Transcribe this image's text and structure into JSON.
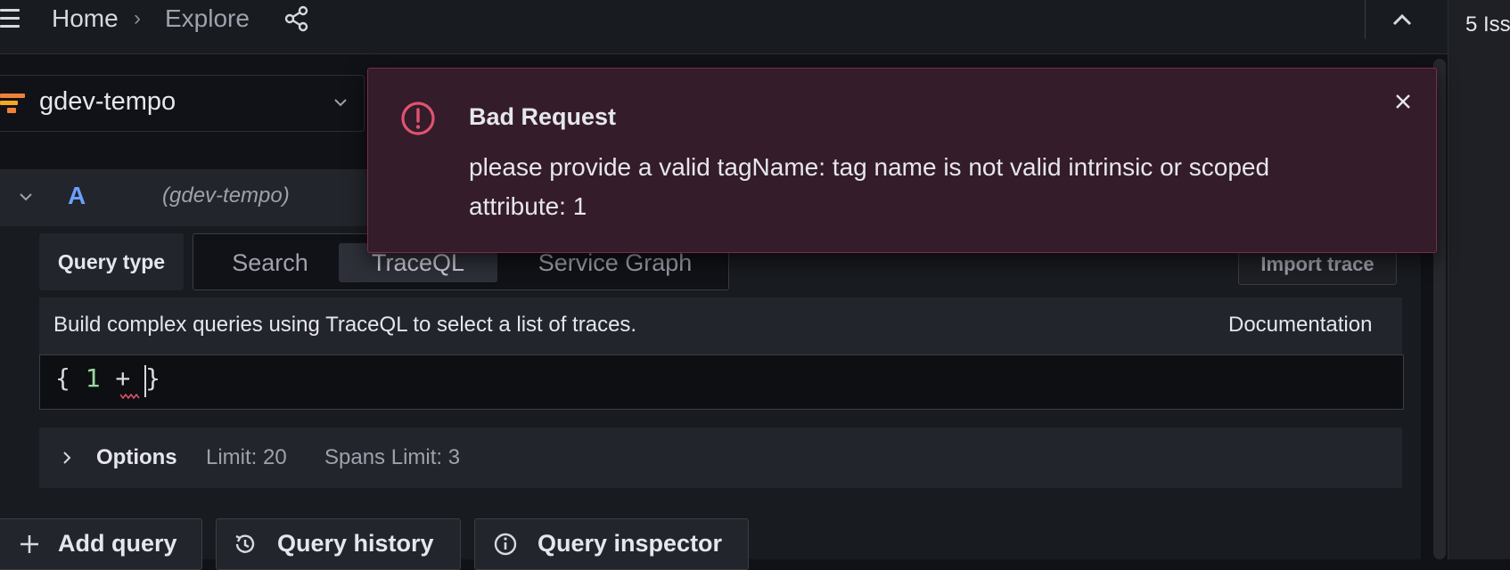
{
  "breadcrumb": {
    "home": "Home",
    "separator": "›",
    "current": "Explore"
  },
  "right_panel": {
    "issues_label": "5 Iss"
  },
  "datasource": {
    "name": "gdev-tempo"
  },
  "query_row": {
    "letter": "A",
    "datasource": "(gdev-tempo)"
  },
  "query_type": {
    "label": "Query type",
    "options": [
      "Search",
      "TraceQL",
      "Service Graph"
    ],
    "selected": "TraceQL"
  },
  "import_trace_label": "Import trace",
  "info": {
    "text": "Build complex queries using TraceQL to select a list of traces.",
    "docs_link": "Documentation"
  },
  "editor": {
    "open": "{ ",
    "number": "1",
    "rest": " + ",
    "close": "}"
  },
  "options": {
    "label": "Options",
    "limit": "Limit: 20",
    "spans_limit": "Spans Limit: 3"
  },
  "buttons": {
    "add_query": "Add query",
    "query_history": "Query history",
    "query_inspector": "Query inspector"
  },
  "alert": {
    "title": "Bad Request",
    "message": "please provide a valid tagName: tag name is not valid intrinsic or scoped attribute: 1"
  },
  "colors": {
    "error": "#e0536f",
    "accent": "#6e9fff",
    "background": "#111217"
  }
}
